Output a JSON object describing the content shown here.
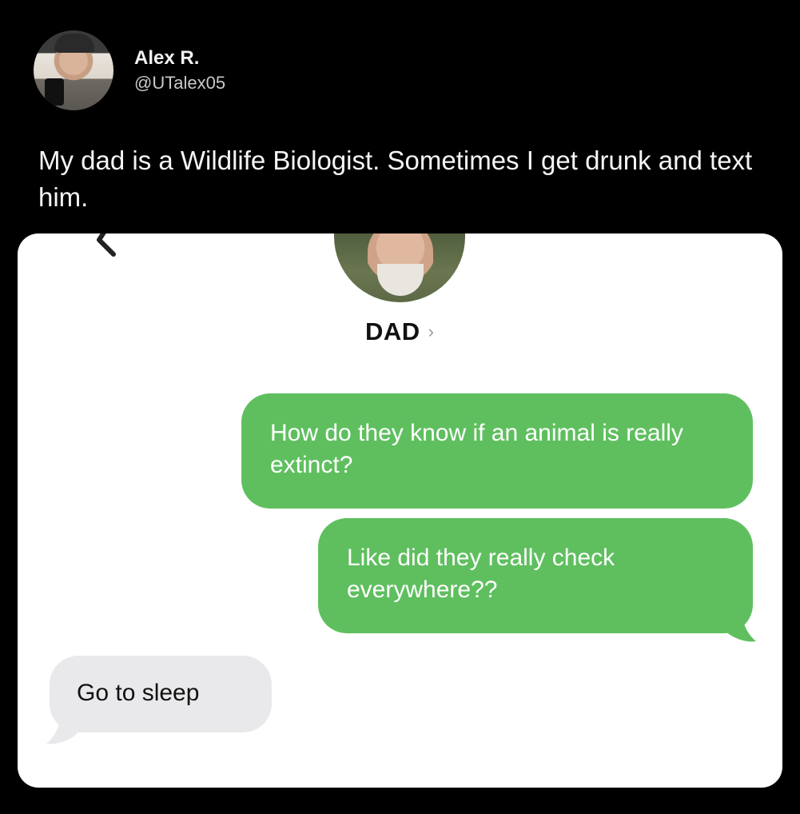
{
  "tweet": {
    "display_name": "Alex R.",
    "handle": "@UTalex05",
    "text": "My dad is a Wildlife Biologist. Sometimes I get drunk and text him."
  },
  "conversation": {
    "contact_name": "DAD",
    "contact_chevron": "›",
    "messages": [
      {
        "direction": "sent",
        "text": "How do they know if an animal is really extinct?"
      },
      {
        "direction": "sent",
        "text": "Like did they really check everywhere??"
      },
      {
        "direction": "received",
        "text": "Go to sleep"
      }
    ]
  },
  "colors": {
    "background": "#000000",
    "sent_bubble": "#5fbf5f",
    "received_bubble": "#e9e9eb",
    "card": "#ffffff"
  },
  "icons": {
    "back": "chevron-left-icon",
    "contact_detail": "chevron-right-icon"
  }
}
